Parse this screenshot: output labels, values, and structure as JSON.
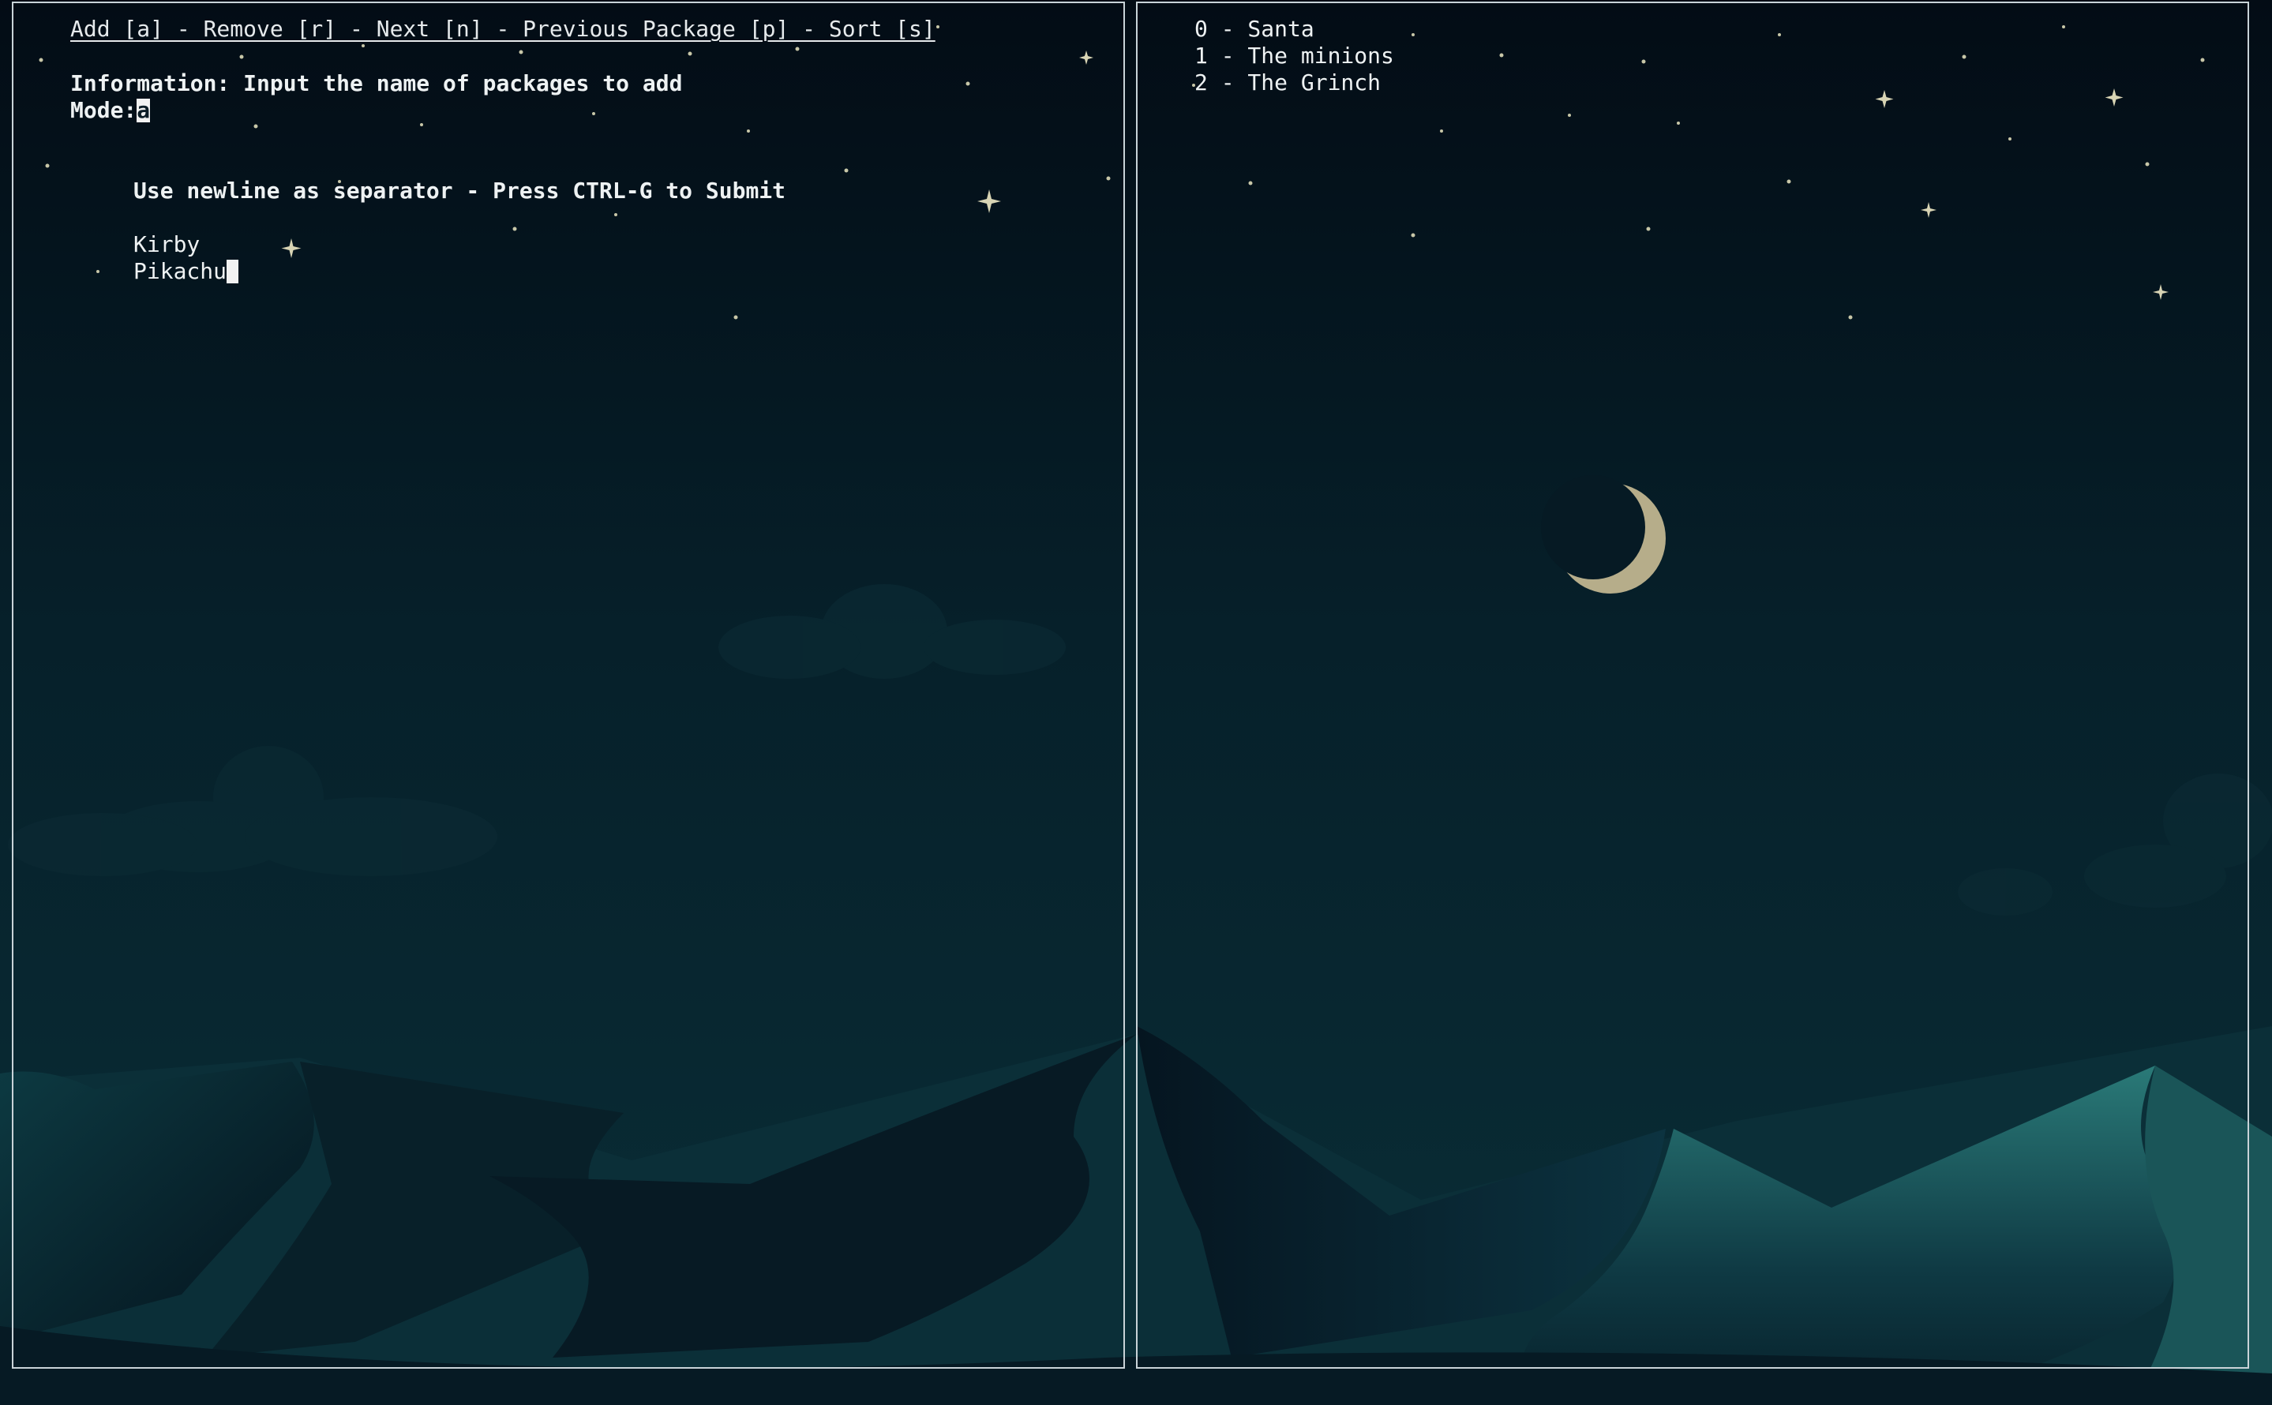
{
  "left_pane": {
    "menu": "Add [a] - Remove [r] - Next [n] - Previous Package [p] - Sort [s]",
    "information": "Information: Input the name of packages to add",
    "mode_label": "Mode:",
    "mode_value": "a",
    "instructions": "Use newline as separator - Press CTRL-G to Submit",
    "input_lines": [
      "Kirby",
      "Pikachu"
    ]
  },
  "right_pane": {
    "packages": [
      "0 - Santa",
      "1 - The minions",
      "2 - The Grinch"
    ]
  },
  "colors": {
    "sky_top": "#051019",
    "sky_bottom": "#0a2a33",
    "dune_light": "#1d5a5c",
    "dune_dark": "#061722",
    "moon": "#b6ad8a",
    "border": "#c9d3d8"
  },
  "icons": [
    "crescent-moon-icon",
    "star-icon"
  ]
}
